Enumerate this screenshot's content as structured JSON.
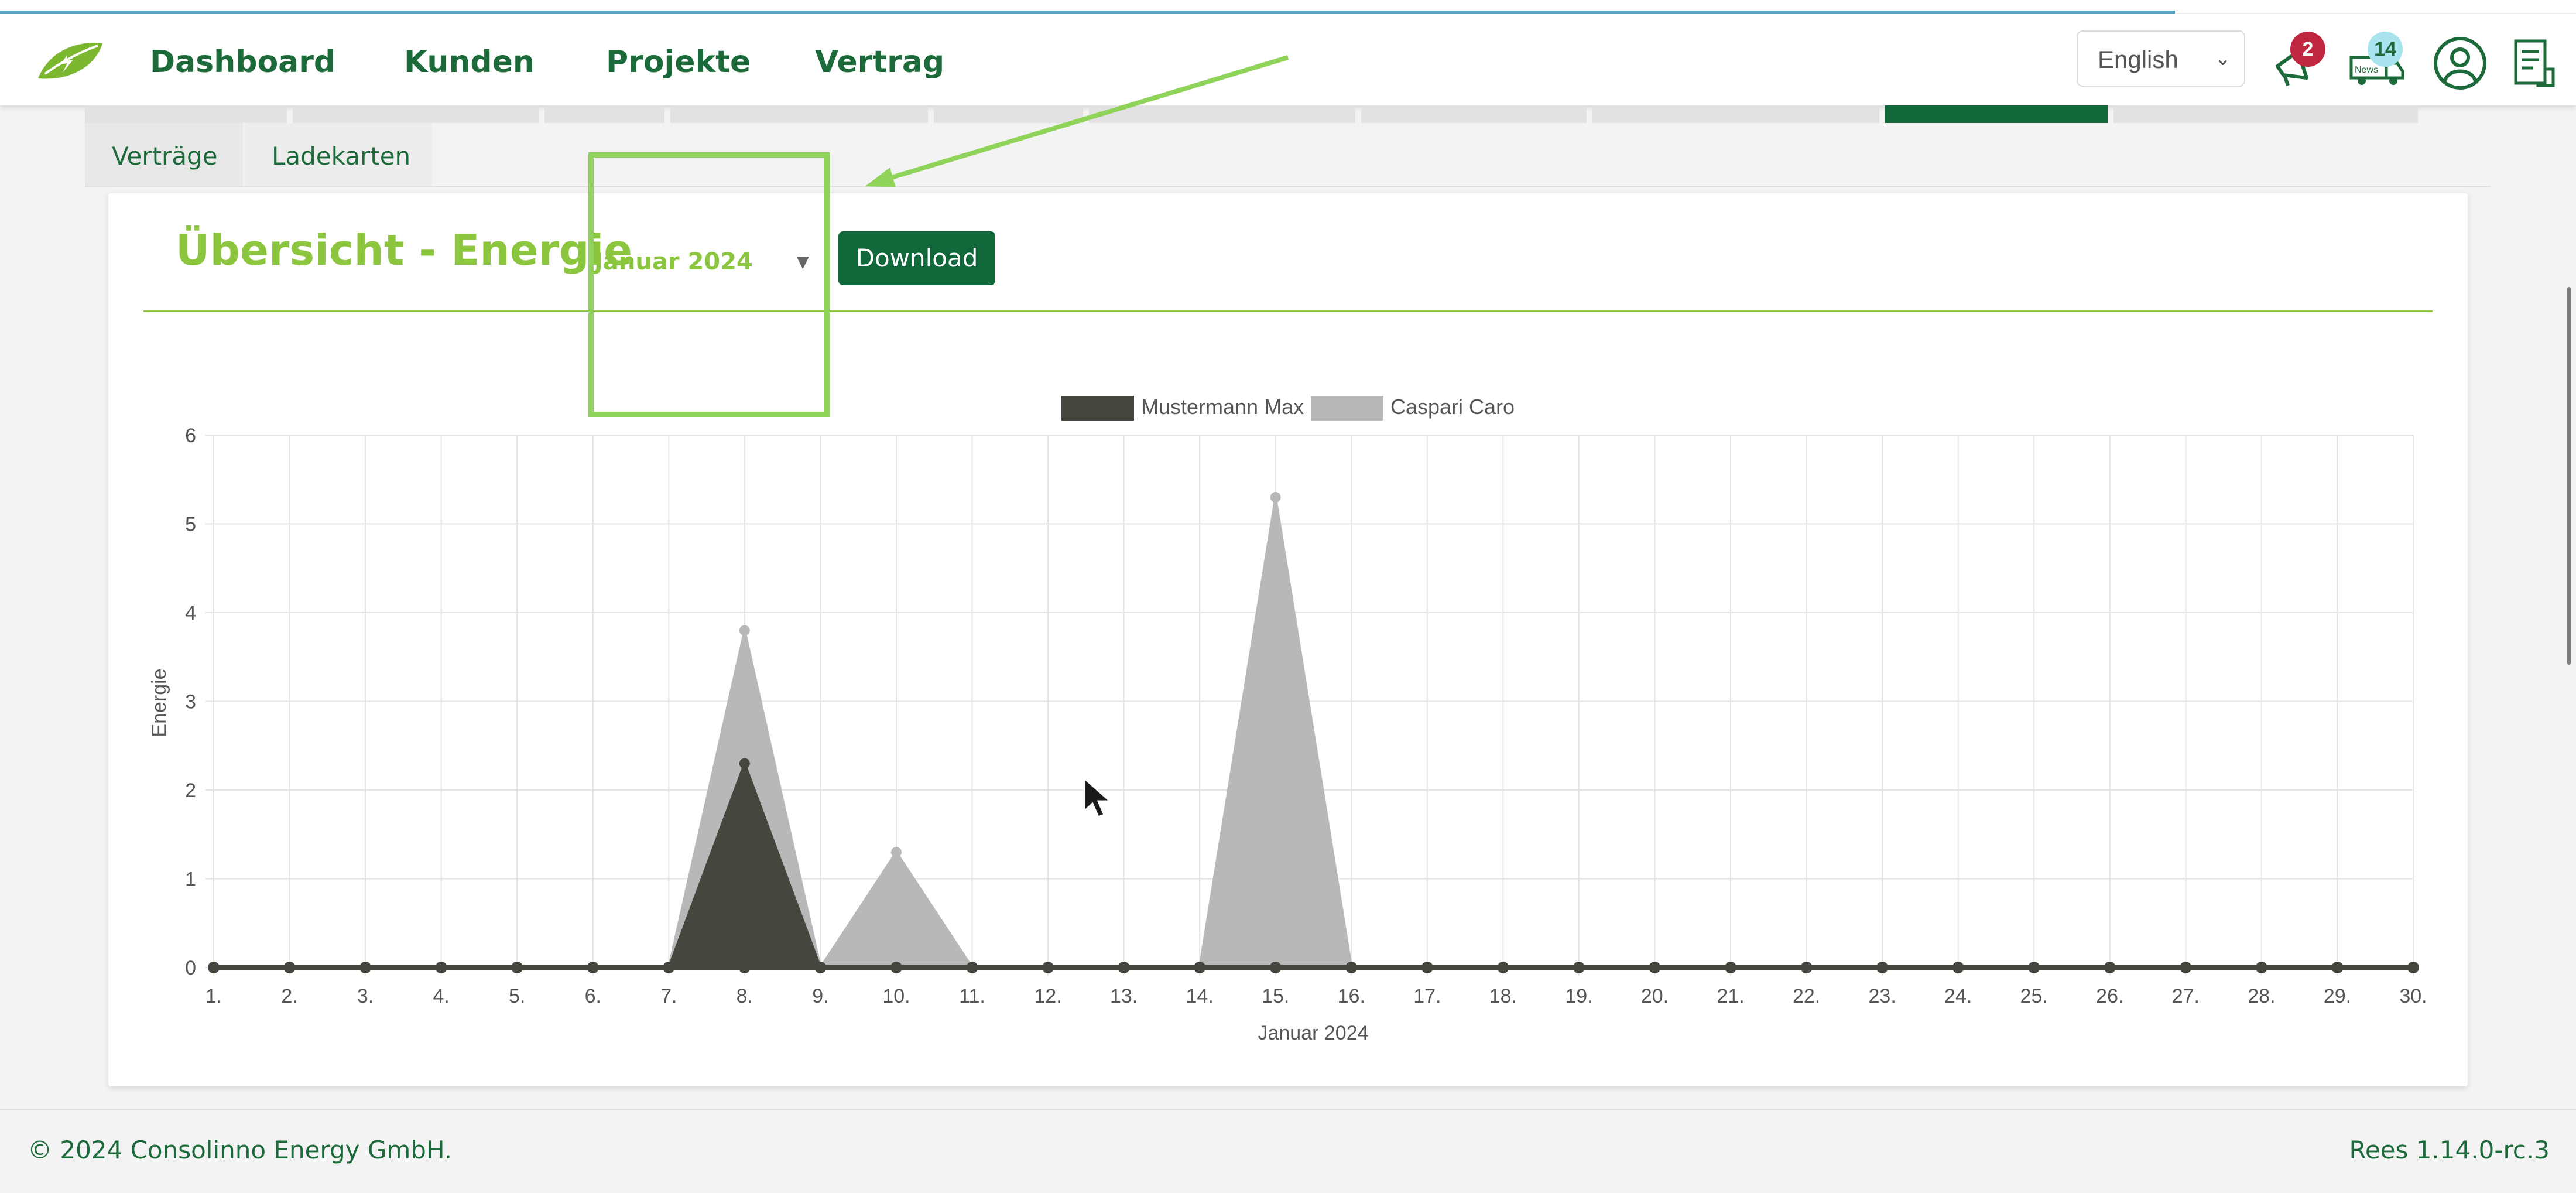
{
  "nav": {
    "links": [
      "Dashboard",
      "Kunden",
      "Projekte",
      "Vertrag"
    ],
    "language": "English",
    "notifications_count": "2",
    "news_count": "14",
    "news_icon_text": "News"
  },
  "subtabs": [
    "Verträge",
    "Ladekarten"
  ],
  "card": {
    "title": "Übersicht - Energie",
    "month_select_value": "Januar 2024",
    "download_label": "Download"
  },
  "chart_data": {
    "type": "area",
    "title": "",
    "xlabel": "Januar 2024",
    "ylabel": "Energie",
    "ylim": [
      0,
      6
    ],
    "yticks": [
      0,
      1,
      2,
      3,
      4,
      5,
      6
    ],
    "x": [
      "1.",
      "2.",
      "3.",
      "4.",
      "5.",
      "6.",
      "7.",
      "8.",
      "9.",
      "10.",
      "11.",
      "12.",
      "13.",
      "14.",
      "15.",
      "16.",
      "17.",
      "18.",
      "19.",
      "20.",
      "21.",
      "22.",
      "23.",
      "24.",
      "25.",
      "26.",
      "27.",
      "28.",
      "29.",
      "30."
    ],
    "grid": true,
    "legend_position": "top",
    "series": [
      {
        "name": "Mustermann Max",
        "color": "#46463f",
        "values": [
          0,
          0,
          0,
          0,
          0,
          0,
          0,
          2.3,
          0,
          0,
          0,
          0,
          0,
          0,
          0,
          0,
          0,
          0,
          0,
          0,
          0,
          0,
          0,
          0,
          0,
          0,
          0,
          0,
          0,
          0
        ]
      },
      {
        "name": "Caspari Caro",
        "color": "#b8b8b8",
        "values": [
          0,
          0,
          0,
          0,
          0,
          0,
          0,
          3.8,
          0,
          1.3,
          0,
          0,
          0,
          0,
          5.3,
          0,
          0,
          0,
          0,
          0,
          0,
          0,
          0,
          0,
          0,
          0,
          0,
          0,
          0,
          0
        ]
      }
    ]
  },
  "footer": {
    "copyright": "© 2024 Consolinno Energy GmbH.",
    "version": "Rees 1.14.0-rc.3"
  }
}
